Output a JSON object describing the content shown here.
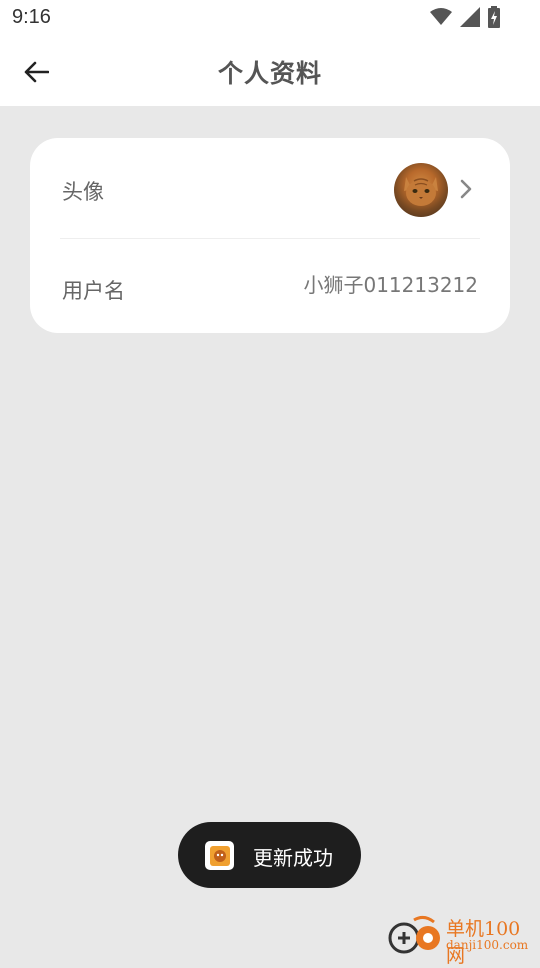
{
  "status_bar": {
    "time": "9:16",
    "icons": [
      "wifi-icon",
      "signal-icon",
      "battery-charging-icon"
    ]
  },
  "header": {
    "title": "个人资料",
    "back_icon": "arrow-left-icon"
  },
  "profile": {
    "avatar_label": "头像",
    "username_label": "用户名",
    "username_value": "小狮子011213212"
  },
  "toast": {
    "message": "更新成功"
  },
  "watermark": {
    "brand": "单机100网",
    "url": "danji100.com"
  },
  "colors": {
    "background": "#e8e8e8",
    "card": "#ffffff",
    "toast_bg": "#1e1e1e",
    "watermark": "#e87722"
  }
}
